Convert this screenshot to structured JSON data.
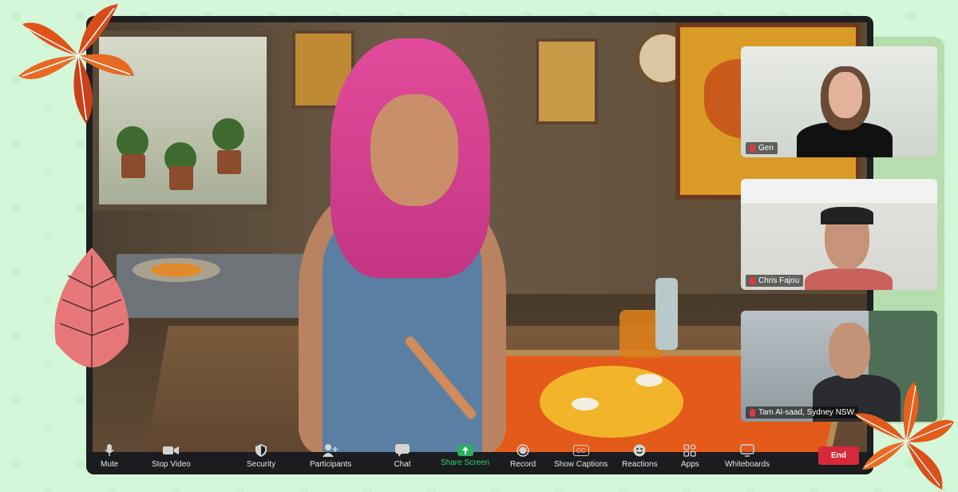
{
  "participants": [
    {
      "name": "Gen"
    },
    {
      "name": "Chris Fajou"
    },
    {
      "name": "Tam Al-saad, Sydney NSW"
    }
  ],
  "toolbar": {
    "mute": "Mute",
    "stop_video": "Stop Video",
    "security": "Security",
    "participants": "Participants",
    "chat": "Chat",
    "share_screen": "Share Screen",
    "record": "Record",
    "show_captions": "Show Captions",
    "captions_badge": "CC",
    "reactions": "Reactions",
    "apps": "Apps",
    "whiteboards": "Whiteboards",
    "end": "End"
  },
  "colors": {
    "background": "#d3f7d8",
    "toolbar": "#1b1c1f",
    "share_green": "#24b35b",
    "end_red": "#d8293a",
    "leaf_orange": "#e05a1c",
    "leaf_pink": "#e8777a"
  },
  "icons": {
    "mute": "microphone-icon",
    "stop_video": "video-camera-icon",
    "security": "shield-icon",
    "participants": "add-person-icon",
    "chat": "speech-bubble-icon",
    "share_screen": "share-arrow-icon",
    "record": "record-circle-icon",
    "reactions": "smiley-icon",
    "apps": "apps-icon",
    "whiteboards": "whiteboard-icon"
  }
}
